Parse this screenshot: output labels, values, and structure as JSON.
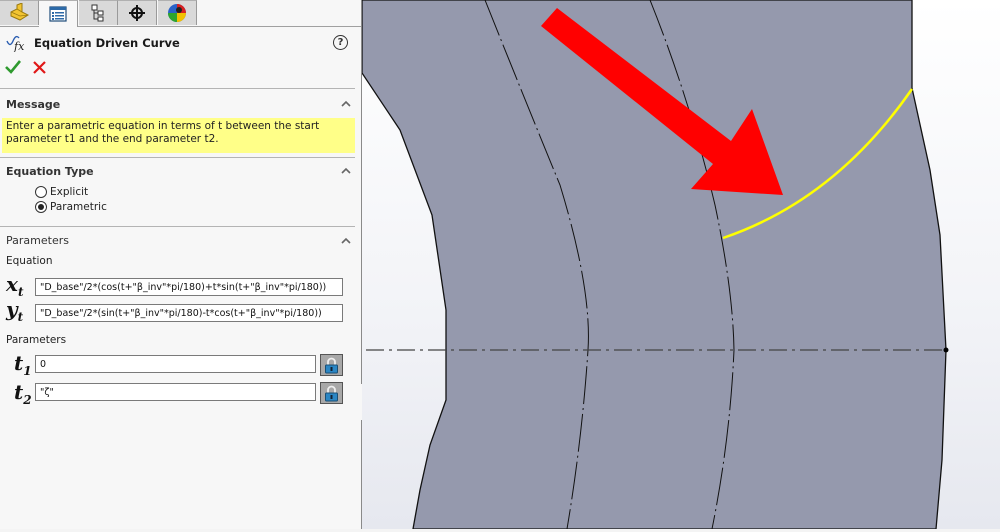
{
  "tabs": [
    {
      "name": "feature-manager",
      "icon": "part-icon"
    },
    {
      "name": "property-manager",
      "icon": "property-list-icon",
      "active": true
    },
    {
      "name": "configuration-manager",
      "icon": "configuration-tree-icon"
    },
    {
      "name": "dimxpert-manager",
      "icon": "crosshair-icon"
    },
    {
      "name": "display-manager",
      "icon": "appearance-ball-icon"
    }
  ],
  "header": {
    "title": "Equation Driven Curve",
    "icon": "fx-curve-icon",
    "help": "?"
  },
  "actions": {
    "ok": "OK",
    "cancel": "Cancel"
  },
  "message": {
    "title": "Message",
    "text": "Enter a parametric equation in terms of t between the start parameter t1 and the end parameter t2."
  },
  "equation_type": {
    "title": "Equation Type",
    "options": [
      {
        "label": "Explicit",
        "selected": false
      },
      {
        "label": "Parametric",
        "selected": true
      }
    ]
  },
  "parameters": {
    "title": "Parameters",
    "equation_label": "Equation",
    "xt_symbol": "x",
    "yt_symbol": "y",
    "t_sub": "t",
    "xt_value": "\"D_base\"/2*(cos(t+\"β_inv\"*pi/180)+t*sin(t+\"β_inv\"*pi/180))",
    "yt_value": "\"D_base\"/2*(sin(t+\"β_inv\"*pi/180)-t*cos(t+\"β_inv\"*pi/180))",
    "params_label": "Parameters",
    "t_symbol": "t",
    "t1_sub": "1",
    "t2_sub": "2",
    "t1_value": "0",
    "t2_value": "\"ζ\""
  },
  "viewport": {
    "part_color": "#9599ad",
    "curve_color": "#ffff00",
    "arrow_color": "#ff0000",
    "edge_color": "#111111"
  }
}
